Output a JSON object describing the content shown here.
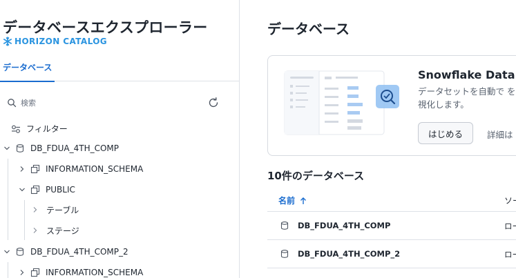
{
  "explorer": {
    "title": "データベースエクスプローラー",
    "brand": "HORIZON CATALOG",
    "tab_label": "データベース",
    "search_placeholder": "検索",
    "filter_label": "フィルター",
    "tree": [
      {
        "label": "DB_FDUA_4TH_COMP",
        "type": "database",
        "expanded": true
      },
      {
        "label": "INFORMATION_SCHEMA",
        "type": "schema",
        "expanded": false
      },
      {
        "label": "PUBLIC",
        "type": "schema",
        "expanded": true
      },
      {
        "label": "テーブル",
        "type": "folder",
        "expanded": false
      },
      {
        "label": "ステージ",
        "type": "folder",
        "expanded": false
      },
      {
        "label": "DB_FDUA_4TH_COMP_2",
        "type": "database",
        "expanded": true
      },
      {
        "label": "INFORMATION_SCHEMA",
        "type": "schema",
        "expanded": false
      }
    ]
  },
  "main": {
    "title": "データベース",
    "promo": {
      "title": "Snowflake Data Qu",
      "description": "データセットを自動で を 可視化します。",
      "start_button": "はじめる",
      "detail_text": "詳細は"
    },
    "list_title": "10件のデータベース",
    "columns": {
      "name": "名前",
      "source": "ソー"
    },
    "rows": [
      {
        "name": "DB_FDUA_4TH_COMP",
        "source": "ロー"
      },
      {
        "name": "DB_FDUA_4TH_COMP_2",
        "source": "ロー"
      }
    ]
  },
  "colors": {
    "accent": "#1a6ccf",
    "brand": "#2a94e0",
    "border": "#dde1e7"
  }
}
